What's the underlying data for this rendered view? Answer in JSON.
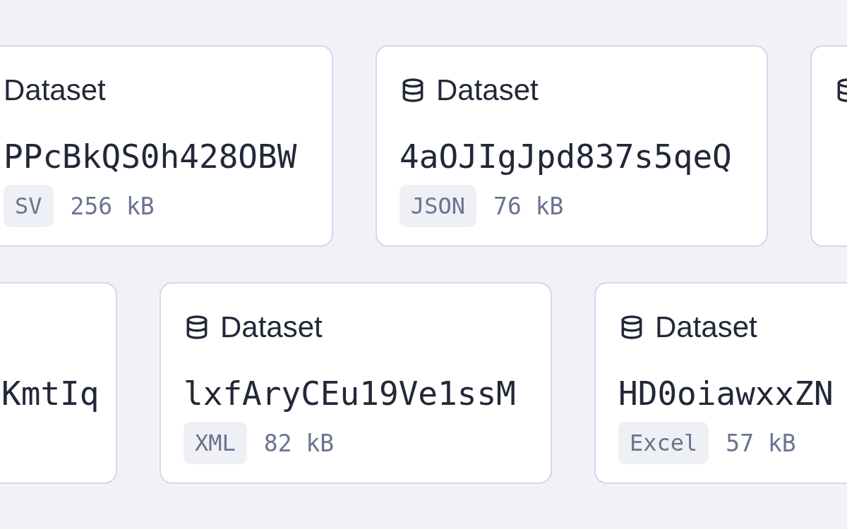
{
  "rows": [
    {
      "cards": [
        {
          "icon": false,
          "title": "Dataset",
          "id": "PPcBkQS0h428OBW",
          "format": "SV",
          "size": "256 kB"
        },
        {
          "icon": true,
          "title": "Dataset",
          "id": "4aOJIgJpd837s5qeQ",
          "format": "JSON",
          "size": "76 kB"
        },
        {
          "icon": true
        }
      ]
    },
    {
      "cards": [
        {
          "icon": false,
          "id": "KmtIq"
        },
        {
          "icon": true,
          "title": "Dataset",
          "id": "lxfAryCEu19Ve1ssM",
          "format": "XML",
          "size": "82 kB"
        },
        {
          "icon": true,
          "title": "Dataset",
          "id": "HD0oiawxxZN",
          "format": "Excel",
          "size": "57 kB"
        }
      ]
    }
  ]
}
